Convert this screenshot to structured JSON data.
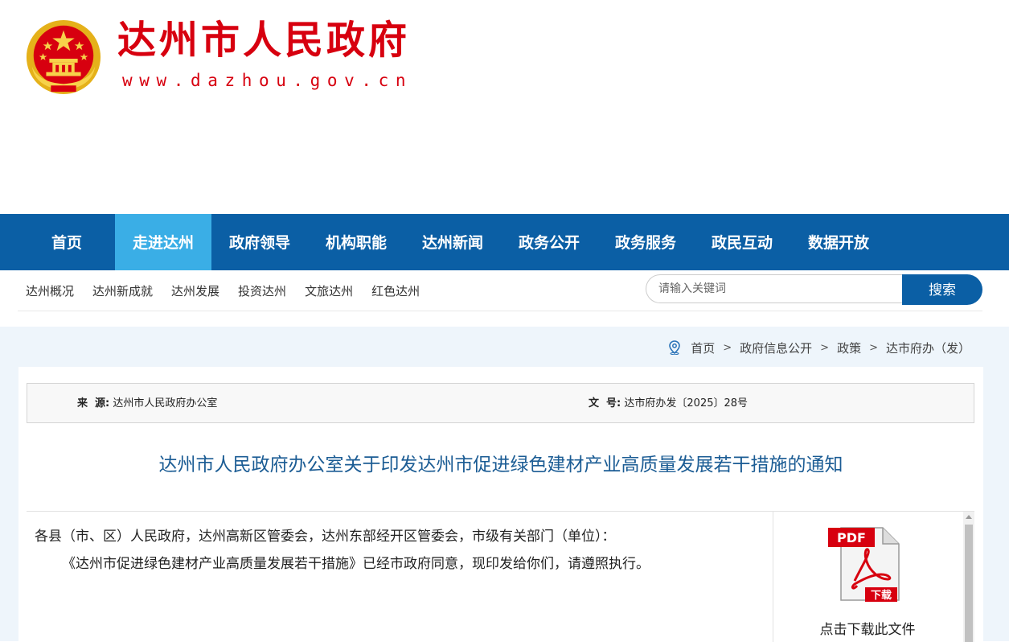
{
  "header": {
    "title": "达州市人民政府",
    "url": "www.dazhou.gov.cn",
    "emblem_icon": "national-emblem-icon",
    "brand_color": "#d7000f"
  },
  "main_nav": {
    "color": "#0b5fa5",
    "active_color": "#3aaee6",
    "items": [
      {
        "label": "首页"
      },
      {
        "label": "走进达州",
        "active": true
      },
      {
        "label": "政府领导"
      },
      {
        "label": "机构职能"
      },
      {
        "label": "达州新闻"
      },
      {
        "label": "政务公开"
      },
      {
        "label": "政务服务"
      },
      {
        "label": "政民互动"
      },
      {
        "label": "数据开放"
      }
    ]
  },
  "sub_nav": {
    "items": [
      "达州概况",
      "达州新成就",
      "达州发展",
      "投资达州",
      "文旅达州",
      "红色达州"
    ]
  },
  "search": {
    "placeholder": "请输入关键词",
    "button_label": "搜索"
  },
  "breadcrumb": {
    "icon": "location-pin-icon",
    "items": [
      "首页",
      "政府信息公开",
      "政策",
      "达市府办（发）"
    ],
    "separator": ">"
  },
  "meta": {
    "source_label": "来  源:",
    "source_value": "达州市人民政府办公室",
    "docno_label": "文  号:",
    "docno_value": "达市府办发〔2025〕28号"
  },
  "document": {
    "title": "达州市人民政府办公室关于印发达州市促进绿色建材产业高质量发展若干措施的通知",
    "paragraphs": [
      "各县（市、区）人民政府，达州高新区管委会，达州东部经开区管委会，市级有关部门（单位）：",
      "《达州市促进绿色建材产业高质量发展若干措施》已经市政府同意，现印发给你们，请遵照执行。"
    ]
  },
  "download": {
    "icon": "pdf-download-icon",
    "pdf_text": "PDF",
    "badge_text": "下载",
    "label": "点击下载此文件"
  }
}
